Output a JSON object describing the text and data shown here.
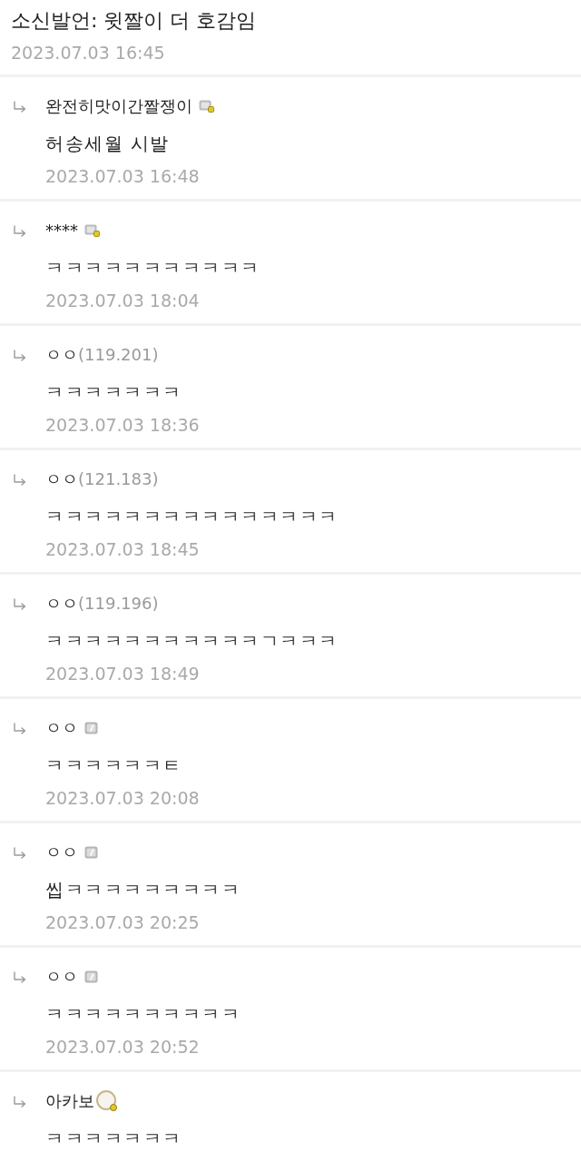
{
  "post": {
    "title": "소신발언: 윗짤이 더 호감임",
    "date": "2023.07.03 16:45"
  },
  "comments": [
    {
      "kind": "fixed",
      "nickname": "완전히맛이간짤쟁이",
      "text": "허송세월 시발",
      "date": "2023.07.03 16:48"
    },
    {
      "kind": "fixed",
      "nickname": "****",
      "text": "ㅋㅋㅋㅋㅋㅋㅋㅋㅋㅋㅋ",
      "date": "2023.07.03 18:04"
    },
    {
      "kind": "guest",
      "nickname": "ㅇㅇ",
      "ip": "(119.201)",
      "text": "ㅋㅋㅋㅋㅋㅋㅋ",
      "date": "2023.07.03 18:36"
    },
    {
      "kind": "guest",
      "nickname": "ㅇㅇ",
      "ip": "(121.183)",
      "text": "ㅋㅋㅋㅋㅋㅋㅋㅋㅋㅋㅋㅋㅋㅋㅋ",
      "date": "2023.07.03 18:45"
    },
    {
      "kind": "guest",
      "nickname": "ㅇㅇ",
      "ip": "(119.196)",
      "text": "ㅋㅋㅋㅋㅋㅋㅋㅋㅋㅋㅋㄱㅋㅋㅋ",
      "date": "2023.07.03 18:49"
    },
    {
      "kind": "semi",
      "nickname": "ㅇㅇ",
      "text": "ㅋㅋㅋㅋㅋㅋㅌ",
      "date": "2023.07.03 20:08"
    },
    {
      "kind": "semi",
      "nickname": "ㅇㅇ",
      "text": "씹ㅋㅋㅋㅋㅋㅋㅋㅋㅋ",
      "date": "2023.07.03 20:25"
    },
    {
      "kind": "semi",
      "nickname": "ㅇㅇ",
      "text": "ㅋㅋㅋㅋㅋㅋㅋㅋㅋㅋ",
      "date": "2023.07.03 20:52"
    },
    {
      "kind": "avatar",
      "nickname": "아카보",
      "text": "ㅋㅋㅋㅋㅋㅋㅋ"
    }
  ]
}
